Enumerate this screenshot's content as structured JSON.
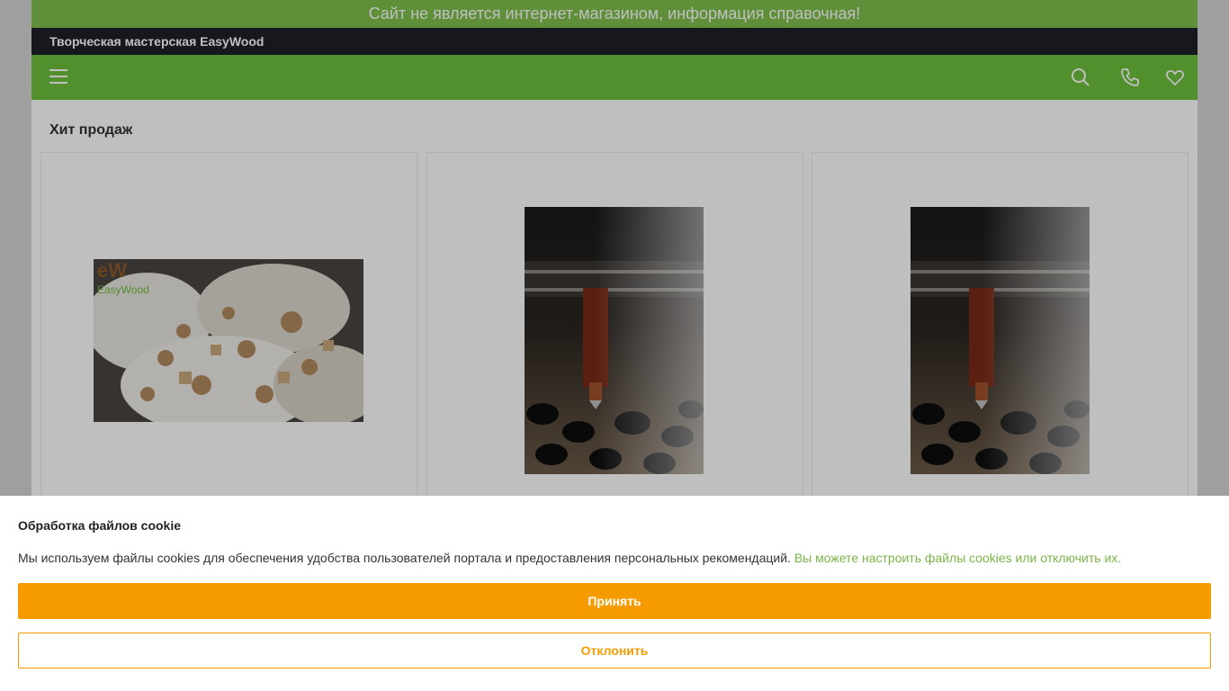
{
  "notice": {
    "text": "Сайт не является интернет-магазином, информация справочная!"
  },
  "brand": {
    "name": "Творческая мастерская EasyWood"
  },
  "nav": {
    "icons": [
      "menu-icon",
      "search-icon",
      "phone-icon",
      "heart-icon"
    ]
  },
  "section": {
    "title": "Хит продаж"
  },
  "products": [
    {
      "image": "wooden-decor-pieces-photo",
      "logo_text": "EasyWood"
    },
    {
      "image": "laser-cutter-photo"
    },
    {
      "image": "laser-cutter-photo"
    }
  ],
  "cookie": {
    "title": "Обработка файлов cookie",
    "text": "Мы используем файлы cookies для обеспечения удобства пользователей портала и предоставления персональных рекомендаций.",
    "link": "Вы можете настроить файлы cookies или отключить их.",
    "accept_label": "Принять",
    "decline_label": "Отклонить"
  },
  "colors": {
    "accent_green": "#6ebf3d",
    "accent_orange": "#f59b00",
    "dark_bar": "#1f2128"
  }
}
